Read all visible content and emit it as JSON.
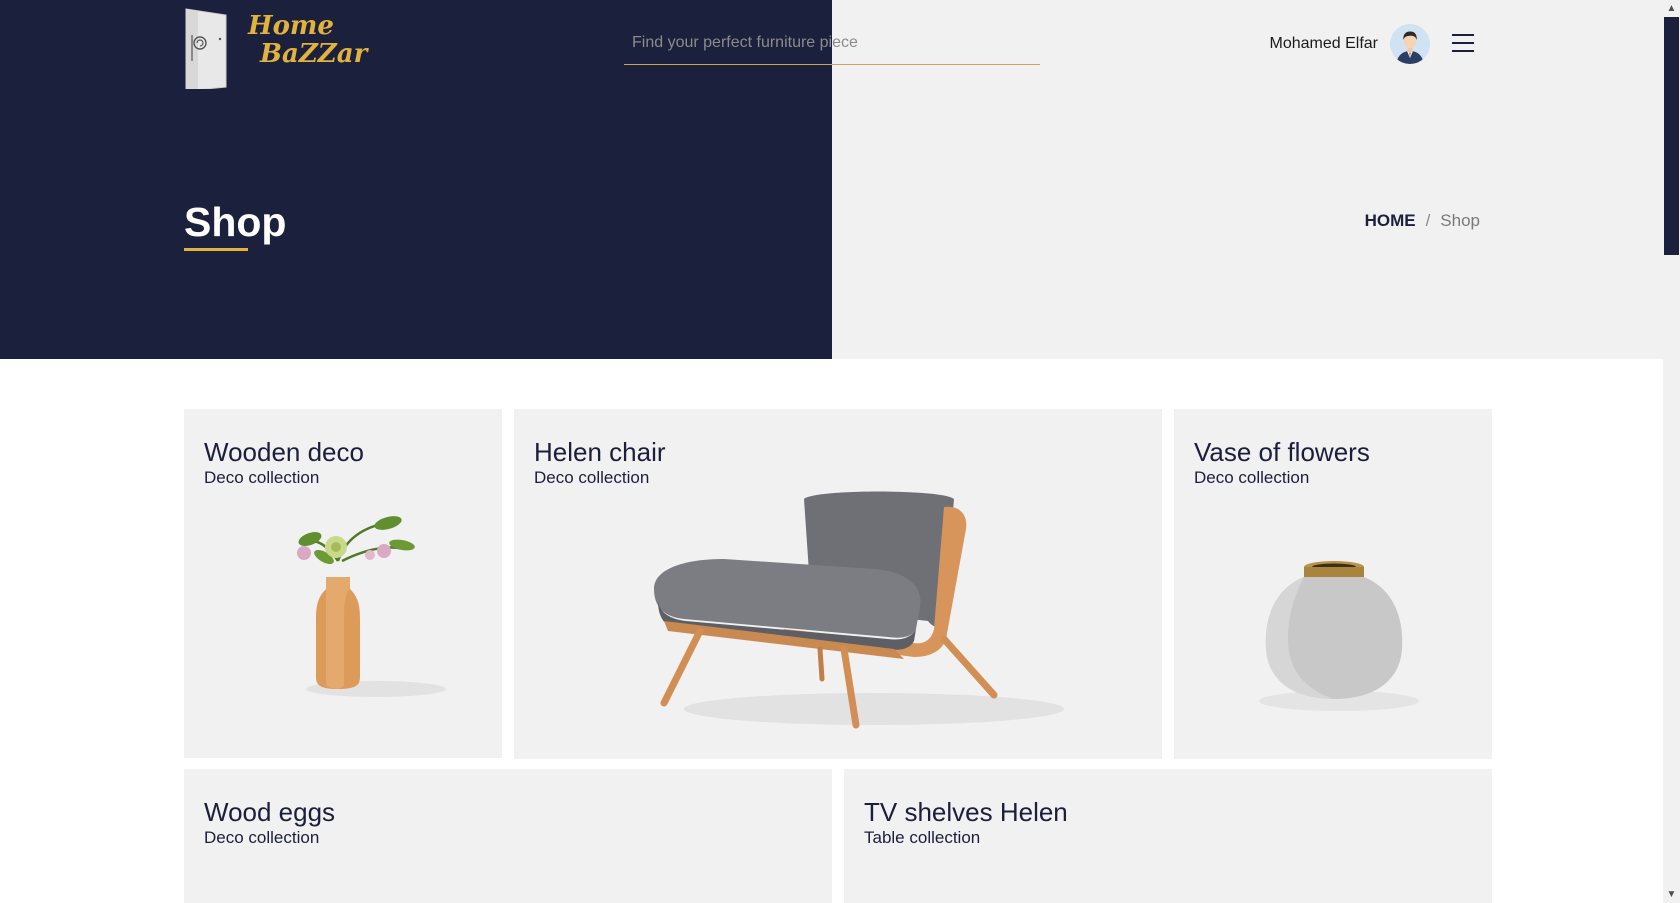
{
  "header": {
    "logo": {
      "line1": "Home",
      "line2": "BaZZar"
    },
    "search_placeholder": "Find your perfect furniture piece",
    "user_name": "Mohamed Elfar"
  },
  "hero": {
    "title": "Shop",
    "breadcrumb": {
      "home": "HOME",
      "separator": "/",
      "current": "Shop"
    }
  },
  "products": [
    {
      "name": "Wooden deco",
      "collection": "Deco collection"
    },
    {
      "name": "Helen chair",
      "collection": "Deco collection"
    },
    {
      "name": "Vase of flowers",
      "collection": "Deco collection"
    },
    {
      "name": "Wood eggs",
      "collection": "Deco collection"
    },
    {
      "name": "TV shelves Helen",
      "collection": "Table collection"
    }
  ],
  "colors": {
    "navy": "#1b213c",
    "gold": "#e2b23e",
    "light_gray": "#f1f1f1"
  },
  "icons": {
    "menu": "hamburger-menu-icon",
    "avatar": "user-avatar",
    "logo": "door-logo-icon"
  }
}
